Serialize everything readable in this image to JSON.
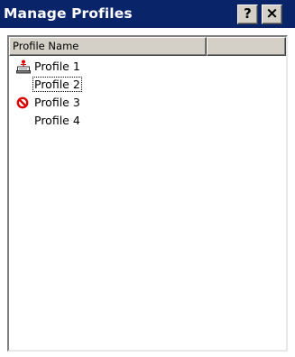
{
  "window": {
    "title": "Manage Profiles",
    "help_label": "?",
    "close_label": "×"
  },
  "table": {
    "columns": [
      "Profile Name",
      ""
    ],
    "rows": [
      {
        "label": "Profile 1",
        "icon": "active-profile-icon",
        "focused": false
      },
      {
        "label": "Profile 2",
        "icon": "",
        "focused": true
      },
      {
        "label": "Profile 3",
        "icon": "disabled-icon",
        "focused": false
      },
      {
        "label": "Profile 4",
        "icon": "",
        "focused": false
      }
    ]
  },
  "colors": {
    "titlebar": "#0a246a",
    "chrome": "#d4d0c8",
    "disabled_icon": "#e00000"
  }
}
